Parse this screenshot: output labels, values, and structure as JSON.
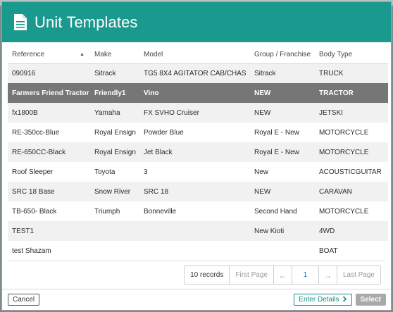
{
  "modal": {
    "title": "Unit Templates",
    "icon": "document-icon"
  },
  "table": {
    "headers": {
      "reference": "Reference",
      "make": "Make",
      "model": "Model",
      "group": "Group / Franchise",
      "body_type": "Body Type"
    },
    "sort_column": "reference",
    "rows": [
      {
        "reference": "090916",
        "make": "Sitrack",
        "model": "TG5 8X4 AGITATOR CAB/CHAS",
        "group": "Sitrack",
        "body_type": "TRUCK",
        "selected": false
      },
      {
        "reference": "Farmers Friend Tractor",
        "make": "Friendly1",
        "model": "Vino",
        "group": "NEW",
        "body_type": "TRACTOR",
        "selected": true
      },
      {
        "reference": "fx1800B",
        "make": "Yamaha",
        "model": "FX SVHO Cruiser",
        "group": "NEW",
        "body_type": "JETSKI",
        "selected": false
      },
      {
        "reference": "RE-350cc-Blue",
        "make": "Royal Ensign",
        "model": "Powder Blue",
        "group": "Royal E - New",
        "body_type": "MOTORCYCLE",
        "selected": false
      },
      {
        "reference": "RE-650CC-Black",
        "make": "Royal Ensign",
        "model": "Jet Black",
        "group": "Royal E - New",
        "body_type": "MOTORCYCLE",
        "selected": false
      },
      {
        "reference": "Roof Sleeper",
        "make": "Toyota",
        "model": "3",
        "group": "New",
        "body_type": "ACOUSTICGUITAR",
        "selected": false
      },
      {
        "reference": "SRC 18 Base",
        "make": "Snow River",
        "model": "SRC 18",
        "group": "NEW",
        "body_type": "CARAVAN",
        "selected": false
      },
      {
        "reference": "TB-650- Black",
        "make": "Triumph",
        "model": "Bonneville",
        "group": "Second Hand",
        "body_type": "MOTORCYCLE",
        "selected": false
      },
      {
        "reference": "TEST1",
        "make": "",
        "model": "",
        "group": "New Kioti",
        "body_type": "4WD",
        "selected": false
      },
      {
        "reference": "test Shazam",
        "make": "",
        "model": "",
        "group": "",
        "body_type": "BOAT",
        "selected": false
      }
    ]
  },
  "pager": {
    "records": "10 records",
    "first": "First Page",
    "prev": "←",
    "current": "1",
    "next": "→",
    "last": "Last Page"
  },
  "footer": {
    "cancel": "Cancel",
    "enter_details": "Enter Details",
    "select": "Select"
  },
  "colors": {
    "header_bg": "#1a9a8f",
    "selected_row": "#767676",
    "accent": "#1a8b82",
    "page_link": "#1a6fc9"
  }
}
